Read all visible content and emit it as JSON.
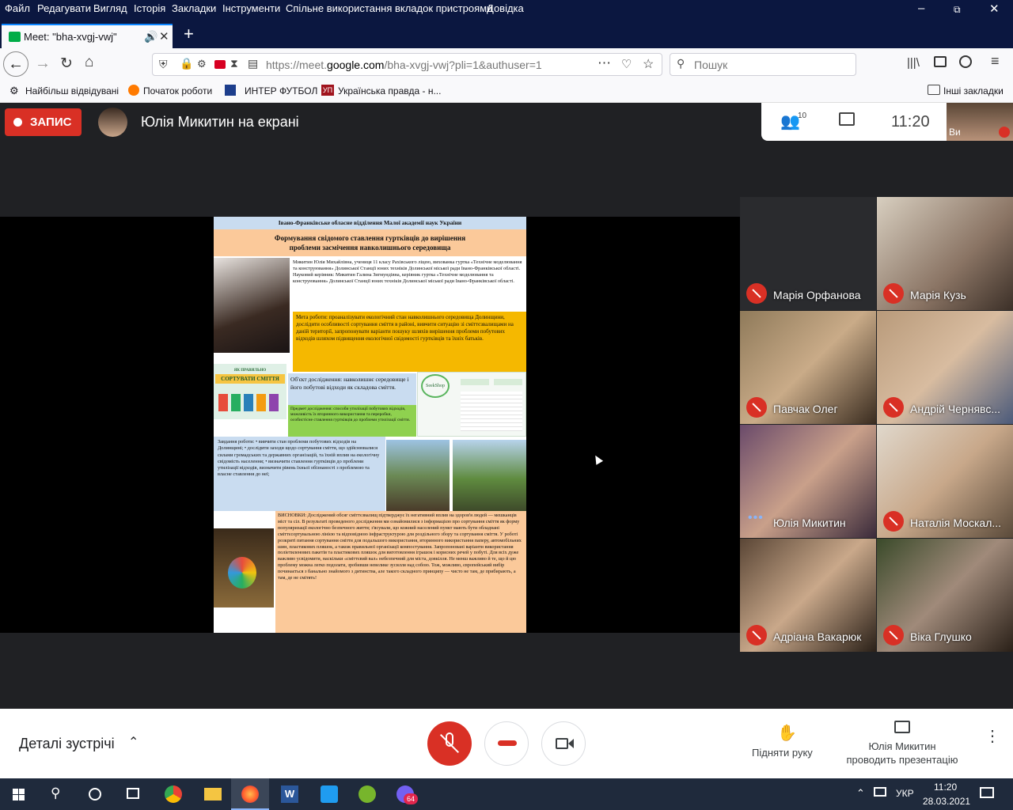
{
  "menu": [
    "Файл",
    "Редагувати",
    "Вигляд",
    "Історія",
    "Закладки",
    "Інструменти",
    "Спільне використання вкладок пристроями",
    "Довідка"
  ],
  "tab": {
    "title": "Meet: \"bha-xvgj-vwj\""
  },
  "url": {
    "prefix": "https://meet.",
    "domain": "google.com",
    "rest": "/bha-xvgj-vwj?pli=1&authuser=1"
  },
  "search": {
    "placeholder": "Пошук"
  },
  "bookmarks": [
    "Найбільш відвідувані",
    "Початок роботи",
    "ИНТЕР ФУТБОЛ",
    "Українська правда - н...",
    "Інші закладки"
  ],
  "meet": {
    "record_label": "ЗАПИС",
    "presenter_title": "Юлія Микитин на екрані",
    "participants_count": "10",
    "clock": "11:20",
    "self_label": "Ви",
    "participants": [
      {
        "name": "Марія Орфанова",
        "muted": true
      },
      {
        "name": "Марія Кузь",
        "muted": true
      },
      {
        "name": "Павчак Олег",
        "muted": true
      },
      {
        "name": "Андрій Чернявс...",
        "muted": true
      },
      {
        "name": "Юлія Микитин",
        "muted": false
      },
      {
        "name": "Наталія Москал...",
        "muted": true
      },
      {
        "name": "Адріана Вакарюк",
        "muted": true
      },
      {
        "name": "Віка Глушко",
        "muted": true
      }
    ],
    "details_label": "Деталі зустрічі",
    "raise_hand_label": "Підняти руку",
    "presenting_line1": "Юлія Микитин",
    "presenting_line2": "проводить презентацію"
  },
  "poster": {
    "header": "Івано-Франківське обласне відділення Малої академії наук України",
    "title1": "Формування свідомого ставлення гуртківців до вирішення",
    "title2": "проблеми засмічення навколишнього середовища",
    "author": "Микитин Юлія Михайлівна, учениця 11 класу Рахівського ліцею, вихованка гуртка «Технічне моделювання та конструювання» Долинської Станції юних техніків Долинської міської ради Івано-Франківської області.",
    "supervisor": "Науковий керівник: Микитин Галина Зигмундівна, керівник гуртка «Технічне моделювання та конструювання» Долинської Станції юних техніків Долинської міської ради Івано-Франківської області.",
    "goal": "Мета роботи: проаналізувати екологічний стан навколишнього середовища Долинщини, дослідити особливості сортування сміття в районі, вивчити ситуацію зі сміттєзвалищами на даній території, запропонувати варіанти пошуку шляхів вирішення проблеми побутових відходів шляхом підвищення екологічної свідомості гуртківців та їхніх батьків.",
    "sort_banner1": "ЯК ПРАВИЛЬНО",
    "sort_banner2": "СОРТУВАТИ СМІТТЯ",
    "object": "Об'єкт дослідження: навколишнє середовище і його побутові відходи як складова сміття.",
    "subject": "Предмет дослідження: способи утилізації побутових відходів, можливість їх вторинного використання та переробки, особистісне ставлення гуртківців до проблеми утилізації сміття.",
    "tasks": "Завдання роботи: • вивчити стан проблеми побутових відходів на Долинщині; • дослідити заходи щодо сортування сміття, що здійснювалися силами громадських та державних організацій, та їхній вплив на екологічну свідомість населення; • визначити ставлення гуртківців до проблеми утилізації відходів, визначити рівень їхньої обізнаності з проблемою та власне ставлення до неї;",
    "conclusions": "ВИСНОВКИ: Досліджений обсяг сміттєзвалищ підтверджує їх негативний вплив на здоров'я людей — мешканців міст та сіл. В результаті проведеного дослідження ми ознайомилися з інформацією про сортування сміття як форму популяризації екологічно безпечного життя; з'ясували, що кожний населений пункт мають бути обладнані сміттєсортувальною лінією та відповідною інфраструктурою для роздільного збору та сортування сміття. У роботі розкриті питання сортування сміття для подальшого використання, вторинного використання паперу, автомобільних шин, пластикових пляшок, а також правильної організації компостування. Запропоновані варіанти використання поліетиленових пакетів та пластикових пляшок для виготовлення іграшок і корисних речей у побуті. Для всіх дуже важливо усвідомити, наскільки «сміттєвий вал» небезпечний для міста, довкілля. Не менш важливо й те, що й цю проблему можна легко подолати, зробивши невелике зусилля над собою. Тож, можливо, європейський вибір починається з банально знайомого з дитинства, але такого складного принципу — чисто не там, де прибирають, а там, де не смітять!",
    "logo_text": "SeekShop"
  },
  "taskbar": {
    "lang": "УКР",
    "time": "11:20",
    "date": "28.03.2021",
    "viber_badge": "64"
  },
  "colors": {
    "menubar": "#0b1740",
    "record": "#d93025",
    "meet_bg": "#202124",
    "poster_blue": "#c9dcf0",
    "poster_orange": "#fbc99a",
    "poster_yellow": "#f5b800"
  }
}
